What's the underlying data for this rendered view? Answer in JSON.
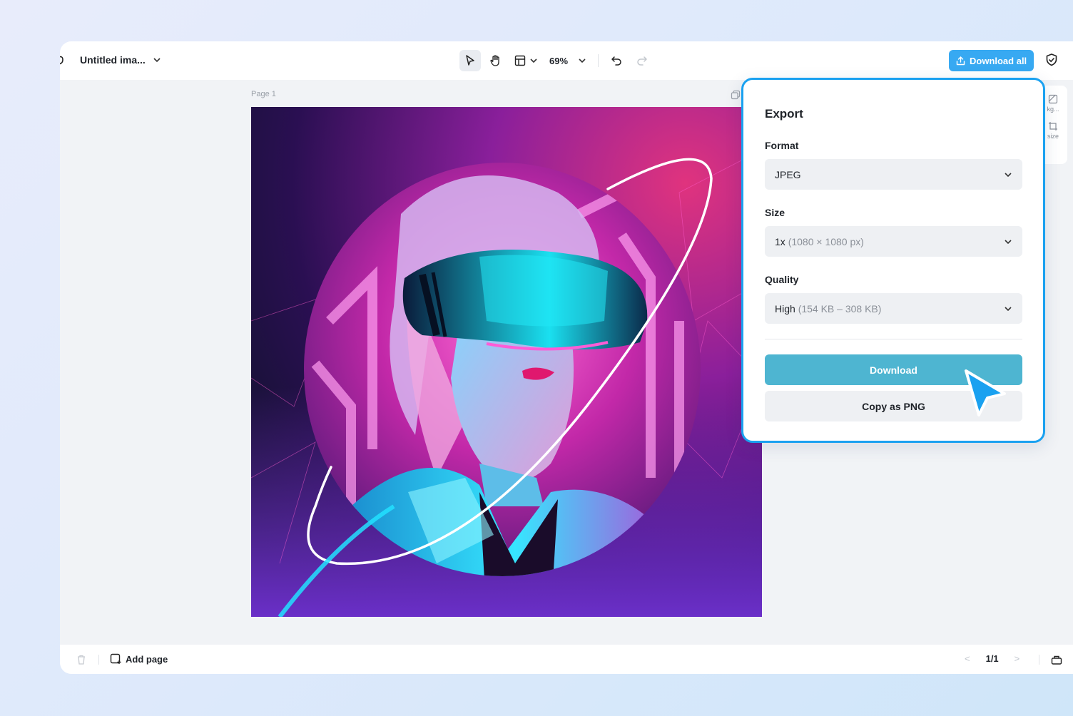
{
  "header": {
    "doc_title": "Untitled ima...",
    "zoom": "69%",
    "download_all": "Download all"
  },
  "canvas": {
    "page_label": "Page 1"
  },
  "right_rail": {
    "items": [
      "kg...",
      "size"
    ]
  },
  "export": {
    "title": "Export",
    "format_label": "Format",
    "format_value": "JPEG",
    "size_label": "Size",
    "size_value": "1x",
    "size_detail": "(1080 × 1080 px)",
    "quality_label": "Quality",
    "quality_value": "High",
    "quality_detail": "(154 KB – 308 KB)",
    "download_button": "Download",
    "copy_button": "Copy as PNG"
  },
  "footer": {
    "add_page": "Add page",
    "page_counter": "1/1"
  },
  "colors": {
    "accent": "#37a9f2",
    "panel_border": "#1aa1f0",
    "download_button": "#4eb5d1"
  }
}
